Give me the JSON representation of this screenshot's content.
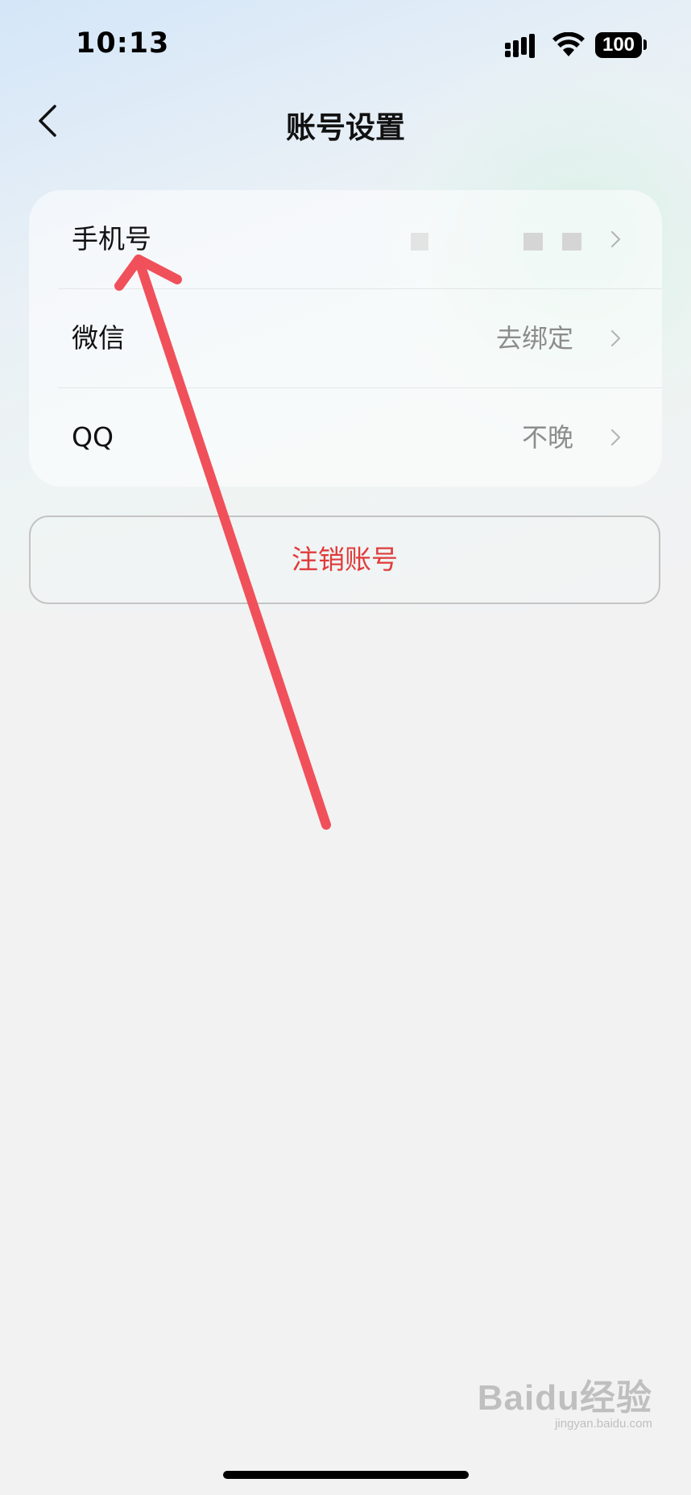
{
  "status_bar": {
    "time": "10:13",
    "battery": "100",
    "signal_icon": "cellular-signal-icon",
    "wifi_icon": "wifi-icon"
  },
  "nav": {
    "title": "账号设置",
    "back_icon": "chevron-left-icon"
  },
  "settings": {
    "rows": [
      {
        "label": "手机号",
        "value": ""
      },
      {
        "label": "微信",
        "value": "去绑定"
      },
      {
        "label": "QQ",
        "value": "不晚"
      }
    ]
  },
  "actions": {
    "delete_account": "注销账号"
  },
  "watermark": {
    "main": "Baidu经验",
    "sub": "jingyan.baidu.com"
  },
  "colors": {
    "accent_red": "#e03a3a",
    "annotation_arrow": "#f0505a"
  }
}
